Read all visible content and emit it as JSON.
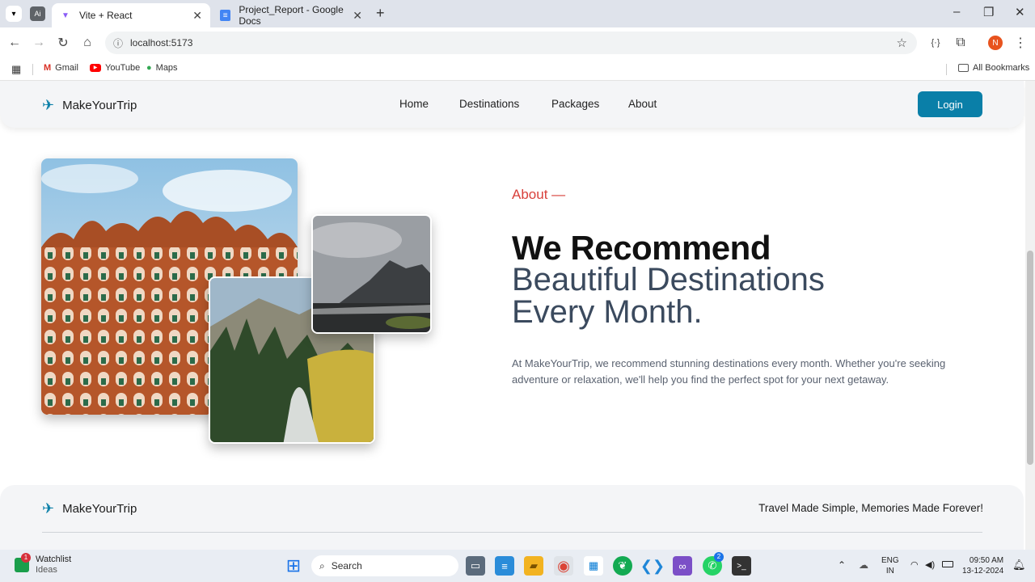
{
  "browser": {
    "tabs": [
      {
        "title": "Vite + React",
        "active": true
      },
      {
        "title": "Project_Report - Google Docs",
        "active": false
      }
    ],
    "url": "localhost:5173",
    "profile_initial": "N",
    "bookmarks": [
      "Gmail",
      "YouTube",
      "Maps"
    ],
    "all_bookmarks": "All Bookmarks"
  },
  "site": {
    "brand": "MakeYourTrip",
    "nav": [
      "Home",
      "Destinations",
      "Packages",
      "About"
    ],
    "login": "Login",
    "about_label": "About —",
    "heading_bold": "We Recommend",
    "heading_line2": "Beautiful Destinations",
    "heading_line3": "Every Month.",
    "description": "At MakeYourTrip, we recommend stunning destinations every month. Whether you're seeking adventure or relaxation, we'll help you find the perfect spot for your next getaway.",
    "footer_brand": "MakeYourTrip",
    "footer_tagline": "Travel Made Simple, Memories Made Forever!",
    "accent_color": "#d8403b",
    "primary_color": "#0a7fa8"
  },
  "taskbar": {
    "widget_title": "Watchlist",
    "widget_sub": "Ideas",
    "widget_badge": "1",
    "search": "Search",
    "whatsapp_badge": "2",
    "lang1": "ENG",
    "lang2": "IN",
    "time": "09:50 AM",
    "date": "13-12-2024"
  }
}
